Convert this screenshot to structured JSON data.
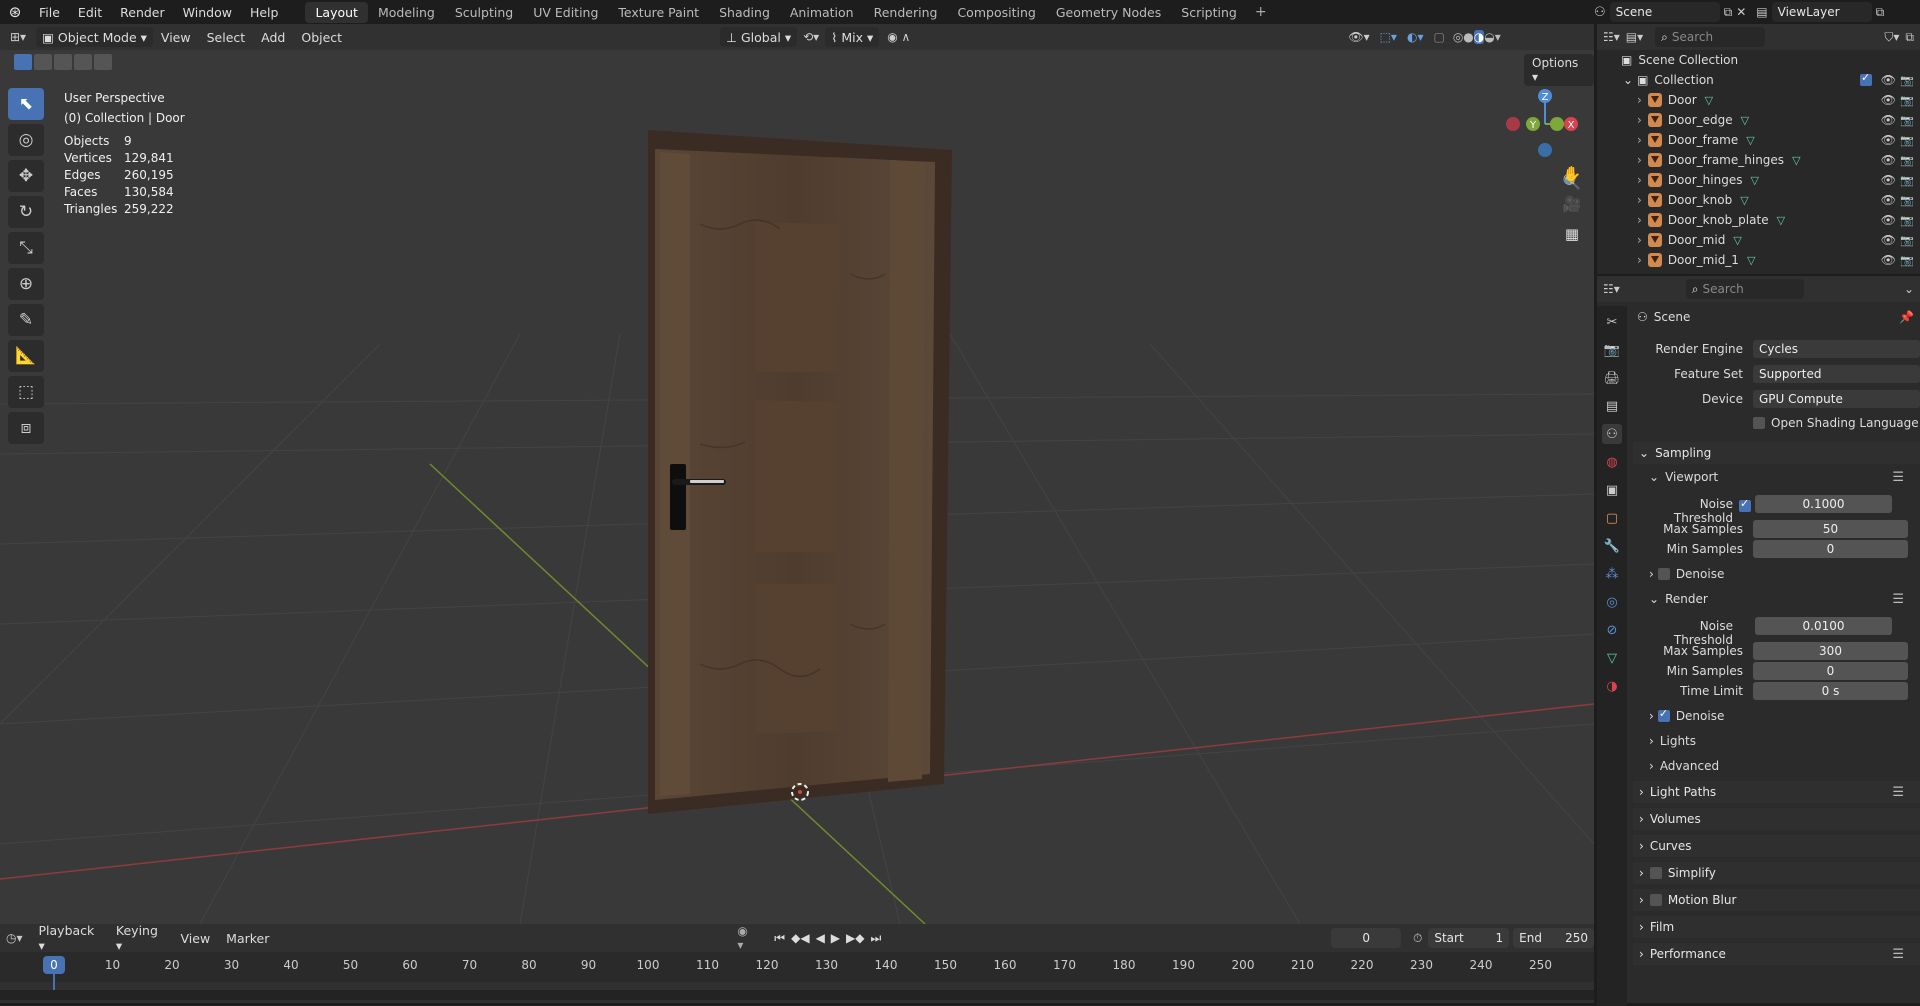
{
  "menu": {
    "file": "File",
    "edit": "Edit",
    "render": "Render",
    "window": "Window",
    "help": "Help"
  },
  "workspaces": [
    "Layout",
    "Modeling",
    "Sculpting",
    "UV Editing",
    "Texture Paint",
    "Shading",
    "Animation",
    "Rendering",
    "Compositing",
    "Geometry Nodes",
    "Scripting"
  ],
  "scene_name": "Scene",
  "view_layer": "ViewLayer",
  "viewport_header": {
    "mode": "Object Mode",
    "view": "View",
    "select": "Select",
    "add": "Add",
    "object": "Object",
    "orientation": "Global",
    "pivot": "Mix",
    "options": "Options"
  },
  "overlay": {
    "perspective": "User Perspective",
    "collection": "(0) Collection | Door"
  },
  "stats": [
    {
      "k": "Objects",
      "v": "9"
    },
    {
      "k": "Vertices",
      "v": "129,841"
    },
    {
      "k": "Edges",
      "v": "260,195"
    },
    {
      "k": "Faces",
      "v": "130,584"
    },
    {
      "k": "Triangles",
      "v": "259,222"
    }
  ],
  "gizmo": {
    "z": "Z",
    "y": "Y",
    "x": "X"
  },
  "timeline": {
    "playback": "Playback",
    "keying": "Keying",
    "view": "View",
    "marker": "Marker",
    "current_frame": "0",
    "start_label": "Start",
    "start": "1",
    "end_label": "End",
    "end": "250",
    "cursor": "0",
    "ticks": [
      "0",
      "10",
      "20",
      "30",
      "40",
      "50",
      "60",
      "70",
      "80",
      "90",
      "100",
      "110",
      "120",
      "130",
      "140",
      "150",
      "160",
      "170",
      "180",
      "190",
      "200",
      "210",
      "220",
      "230",
      "240",
      "250"
    ]
  },
  "outliner": {
    "search": "Search",
    "scene_collection": "Scene Collection",
    "collection": "Collection",
    "items": [
      "Door",
      "Door_edge",
      "Door_frame",
      "Door_frame_hinges",
      "Door_hinges",
      "Door_knob",
      "Door_knob_plate",
      "Door_mid",
      "Door_mid_1"
    ]
  },
  "properties": {
    "search": "Search",
    "context": "Scene",
    "render_engine_label": "Render Engine",
    "render_engine": "Cycles",
    "feature_set_label": "Feature Set",
    "feature_set": "Supported",
    "device_label": "Device",
    "device": "GPU Compute",
    "osl": "Open Shading Language",
    "sampling": "Sampling",
    "viewport": "Viewport",
    "noise_threshold_label": "Noise Threshold",
    "vp_noise": "0.1000",
    "max_samples_label": "Max Samples",
    "vp_max": "50",
    "min_samples_label": "Min Samples",
    "vp_min": "0",
    "denoise": "Denoise",
    "render": "Render",
    "r_noise": "0.0100",
    "r_max": "300",
    "r_min": "0",
    "time_limit_label": "Time Limit",
    "r_time": "0 s",
    "lights": "Lights",
    "advanced": "Advanced",
    "light_paths": "Light Paths",
    "volumes": "Volumes",
    "curves": "Curves",
    "simplify": "Simplify",
    "motion_blur": "Motion Blur",
    "film": "Film",
    "performance": "Performance"
  },
  "colors": {
    "accent": "#4772b3",
    "x_axis": "#d9434f",
    "y_axis": "#7ea83a",
    "z_axis": "#4f8ed6"
  }
}
